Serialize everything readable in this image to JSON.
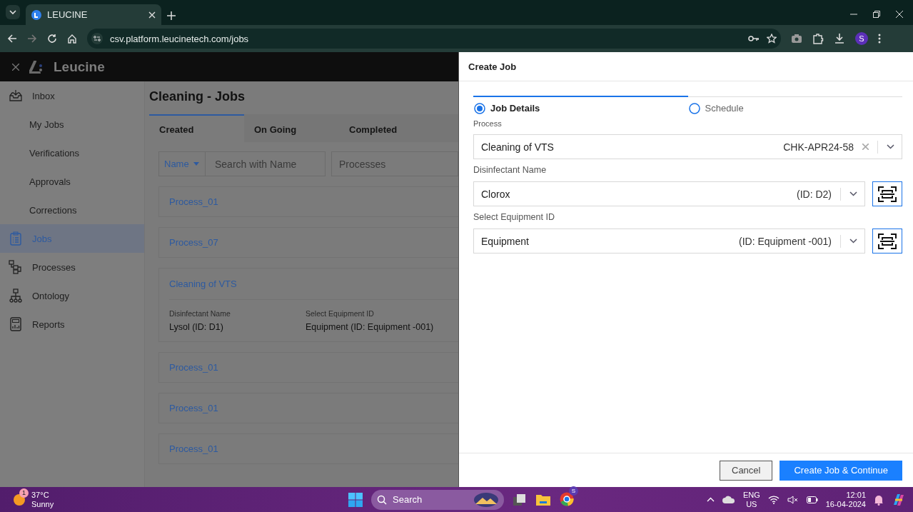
{
  "browser": {
    "tab_title": "LEUCINE",
    "url": "csv.platform.leucinetech.com/jobs",
    "profile_initial": "S"
  },
  "app": {
    "brand": "Leucine"
  },
  "sidebar": {
    "items": [
      {
        "label": "Inbox",
        "kind": "main",
        "selected": false
      },
      {
        "label": "My Jobs",
        "kind": "sub",
        "selected": false
      },
      {
        "label": "Verifications",
        "kind": "sub",
        "selected": false
      },
      {
        "label": "Approvals",
        "kind": "sub",
        "selected": false
      },
      {
        "label": "Corrections",
        "kind": "sub",
        "selected": false
      },
      {
        "label": "Jobs",
        "kind": "main",
        "selected": true
      },
      {
        "label": "Processes",
        "kind": "main",
        "selected": false
      },
      {
        "label": "Ontology",
        "kind": "main",
        "selected": false
      },
      {
        "label": "Reports",
        "kind": "main",
        "selected": false
      }
    ]
  },
  "page": {
    "title": "Cleaning - Jobs",
    "tabs": [
      {
        "label": "Created",
        "selected": true
      },
      {
        "label": "On Going",
        "selected": false
      },
      {
        "label": "Completed",
        "selected": false
      }
    ],
    "filter": {
      "field": "Name",
      "search_placeholder": "Search with Name",
      "process_placeholder": "Processes"
    },
    "jobs": [
      {
        "name": "Process_01",
        "kind": "simple"
      },
      {
        "name": "Process_07",
        "kind": "simple"
      },
      {
        "name": "Cleaning of VTS",
        "kind": "detailed",
        "fields": [
          {
            "label": "Disinfectant Name",
            "value": "Lysol (ID: D1)"
          },
          {
            "label": "Select Equipment ID",
            "value": "Equipment (ID: Equipment -001)"
          }
        ]
      },
      {
        "name": "Process_01",
        "kind": "simple"
      },
      {
        "name": "Process_01",
        "kind": "simple"
      },
      {
        "name": "Process_01",
        "kind": "simple"
      }
    ]
  },
  "panel": {
    "title": "Create Job",
    "steps": [
      {
        "label": "Job Details",
        "selected": true
      },
      {
        "label": "Schedule",
        "selected": false
      }
    ],
    "fields": [
      {
        "label": "Process",
        "value": "Cleaning of VTS",
        "code": "CHK-APR24-58",
        "clearable": true,
        "scan": false
      },
      {
        "label": "Disinfectant Name",
        "value": "Clorox",
        "code": "(ID: D2)",
        "clearable": false,
        "scan": true
      },
      {
        "label": "Select Equipment ID",
        "value": "Equipment",
        "code": "(ID: Equipment -001)",
        "clearable": false,
        "scan": true
      }
    ],
    "cancel": "Cancel",
    "submit": "Create Job & Continue"
  },
  "taskbar": {
    "weather_badge": "1",
    "temperature": "37°C",
    "condition": "Sunny",
    "search": "Search",
    "chrome_badge": "S",
    "language": "ENG",
    "region": "US",
    "time": "12:01",
    "date": "16-04-2024"
  }
}
